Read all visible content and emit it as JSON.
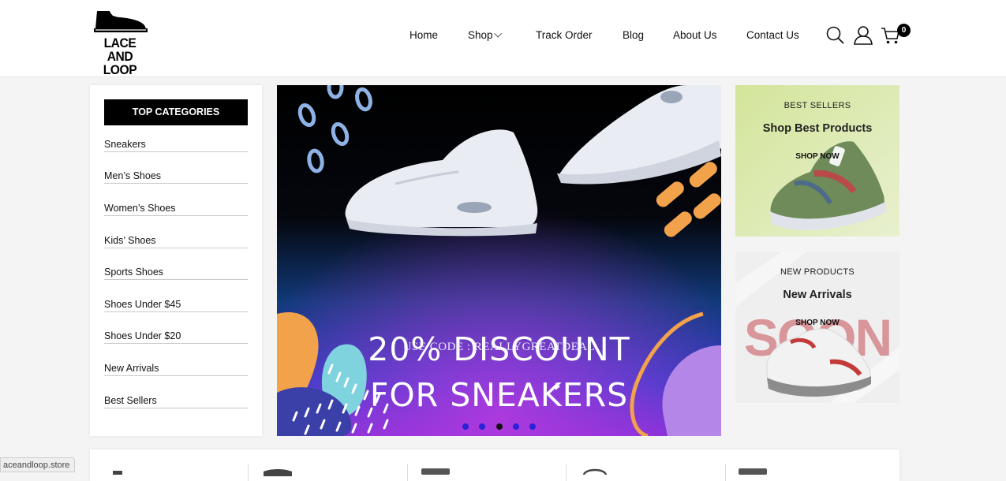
{
  "brand": {
    "logo_text": "LACE AND LOOP",
    "logo_line1": "LACE AND",
    "logo_line2": "LOOP"
  },
  "nav": {
    "items": [
      {
        "label": "Home"
      },
      {
        "label": "Shop"
      },
      {
        "label": "Track Order"
      },
      {
        "label": "Blog"
      },
      {
        "label": "About Us"
      },
      {
        "label": "Contact Us"
      }
    ],
    "cart_count": "0"
  },
  "sidebar": {
    "title": "TOP CATEGORIES",
    "items": [
      {
        "label": "Sneakers"
      },
      {
        "label": "Men’s Shoes"
      },
      {
        "label": "Women’s Shoes"
      },
      {
        "label": "Kids’ Shoes"
      },
      {
        "label": "Sports Shoes"
      },
      {
        "label": "Shoes Under $45"
      },
      {
        "label": "Shoes Under $20"
      },
      {
        "label": "New Arrivals"
      },
      {
        "label": "Best Sellers"
      }
    ]
  },
  "banner": {
    "line1": "20% DISCOUNT",
    "line2": "FOR SNEAKERS",
    "code": "USE CODE : REALLYGREATDEAL",
    "slide_count": 5,
    "active_slide": 3
  },
  "promos": [
    {
      "tag": "BEST SELLERS",
      "title": "Shop Best Products",
      "button": "SHOP NOW",
      "bg": "#d9e9a8"
    },
    {
      "tag": "NEW PRODUCTS",
      "title": "New Arrivals",
      "button": "SHOP NOW",
      "overlay": "SOON",
      "bg": "#efefef"
    }
  ],
  "status_bar": {
    "url": "aceandloop.store"
  },
  "colors": {
    "accent": "#000000",
    "dot": "#2a22d6"
  }
}
